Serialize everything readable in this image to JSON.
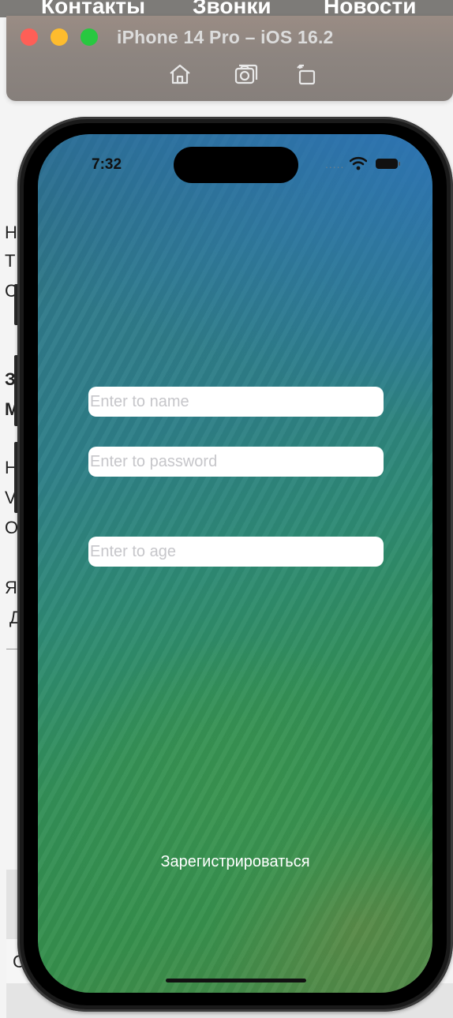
{
  "background_app": {
    "tabs": [
      "Контакты",
      "Звонки",
      "Новости"
    ],
    "side_letters": [
      "Н",
      "Т",
      "С",
      "З",
      "М",
      "Н",
      "V",
      "О",
      "Я",
      "Д",
      "С"
    ]
  },
  "simulator": {
    "title": "iPhone 14 Pro – iOS 16.2",
    "icons": [
      "home-icon",
      "screenshot-icon",
      "rotate-icon"
    ]
  },
  "status_bar": {
    "time": "7:32",
    "signal": "....."
  },
  "form": {
    "name_placeholder": "Enter to name",
    "password_placeholder": "Enter to password",
    "age_placeholder": "Enter to age",
    "name_value": "",
    "password_value": "",
    "age_value": "",
    "register_label": "Зарегистрироваться"
  },
  "colors": {
    "accent_white": "#ffffff",
    "placeholder": "#c6c6ca",
    "traffic_red": "#fe5f57",
    "traffic_yellow": "#febc2e",
    "traffic_green": "#28c840"
  }
}
